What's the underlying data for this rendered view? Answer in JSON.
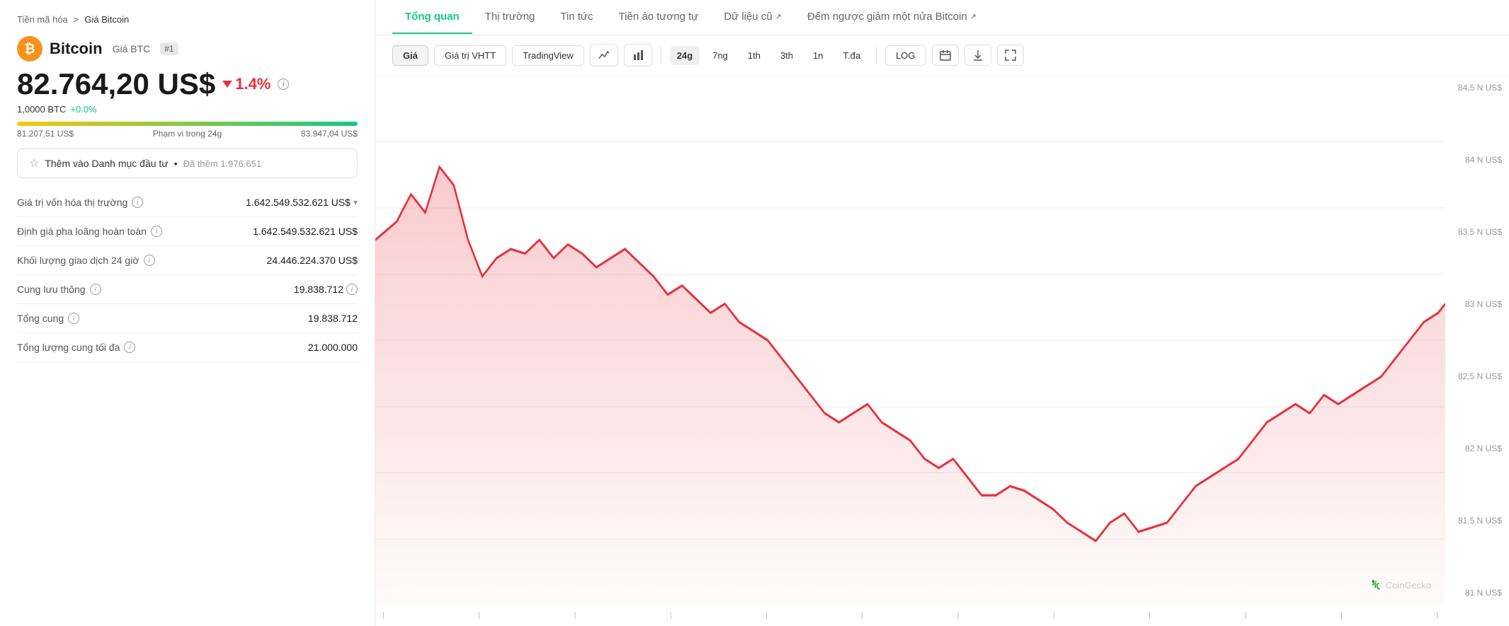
{
  "breadcrumb": {
    "root": "Tiền mã hóa",
    "separator": ">",
    "current": "Giá Bitcoin"
  },
  "coin": {
    "symbol": "₿",
    "name": "Bitcoin",
    "ticker_label": "Giá BTC",
    "rank": "#1",
    "price": "82.764,20 US$",
    "change_percent": "1.4%",
    "btc_amount": "1,0000 BTC",
    "btc_change": "+0.0%",
    "range_low": "81.207,51 US$",
    "range_label": "Phạm vi trong 24g",
    "range_high": "83.947,04 US$"
  },
  "watchlist": {
    "label": "Thêm vào Danh mục đầu tư",
    "separator": "•",
    "count": "Đã thêm 1.976.651"
  },
  "stats": [
    {
      "label": "Giá trị vốn hóa thị trường",
      "value": "1.642.549.532.621 US$",
      "has_chevron": true
    },
    {
      "label": "Định giá pha loãng hoàn toàn",
      "value": "1.642.549.532.621 US$",
      "has_chevron": false
    },
    {
      "label": "Khối lượng giao dịch 24 giờ",
      "value": "24.446.224.370 US$",
      "has_chevron": false
    },
    {
      "label": "Cung lưu thông",
      "value": "19.838.712",
      "has_info": true
    },
    {
      "label": "Tổng cung",
      "value": "19.838.712",
      "has_chevron": false
    },
    {
      "label": "Tổng lượng cung tối đa",
      "value": "21.000.000",
      "has_chevron": false
    }
  ],
  "tabs": [
    {
      "label": "Tổng quan",
      "active": true,
      "external": false
    },
    {
      "label": "Thị trường",
      "active": false,
      "external": false
    },
    {
      "label": "Tin tức",
      "active": false,
      "external": false
    },
    {
      "label": "Tiền ảo tương tự",
      "active": false,
      "external": false
    },
    {
      "label": "Dữ liệu cũ",
      "active": false,
      "external": true
    },
    {
      "label": "Đếm ngược giảm một nửa Bitcoin",
      "active": false,
      "external": true
    }
  ],
  "chart_controls": {
    "type_buttons": [
      "Giá",
      "Giá trị VHTT",
      "TradingView"
    ],
    "icon_buttons": [
      "line-chart",
      "bar-chart"
    ],
    "time_buttons": [
      "24g",
      "7ng",
      "1th",
      "3th",
      "1n",
      "T.đa"
    ],
    "active_time": "24g",
    "extra_buttons": [
      "LOG",
      "calendar",
      "download",
      "expand"
    ]
  },
  "y_axis_labels": [
    "84,5 N US$",
    "84 N US$",
    "83,5 N US$",
    "83 N US$",
    "82,5 N US$",
    "82 N US$",
    "81,5 N US$",
    "81 N US$"
  ],
  "watermark": "CoinGecko",
  "colors": {
    "accent_green": "#16c784",
    "accent_red": "#e8303a",
    "chart_line": "#e8303a",
    "chart_fill": "rgba(232,48,58,0.12)"
  }
}
